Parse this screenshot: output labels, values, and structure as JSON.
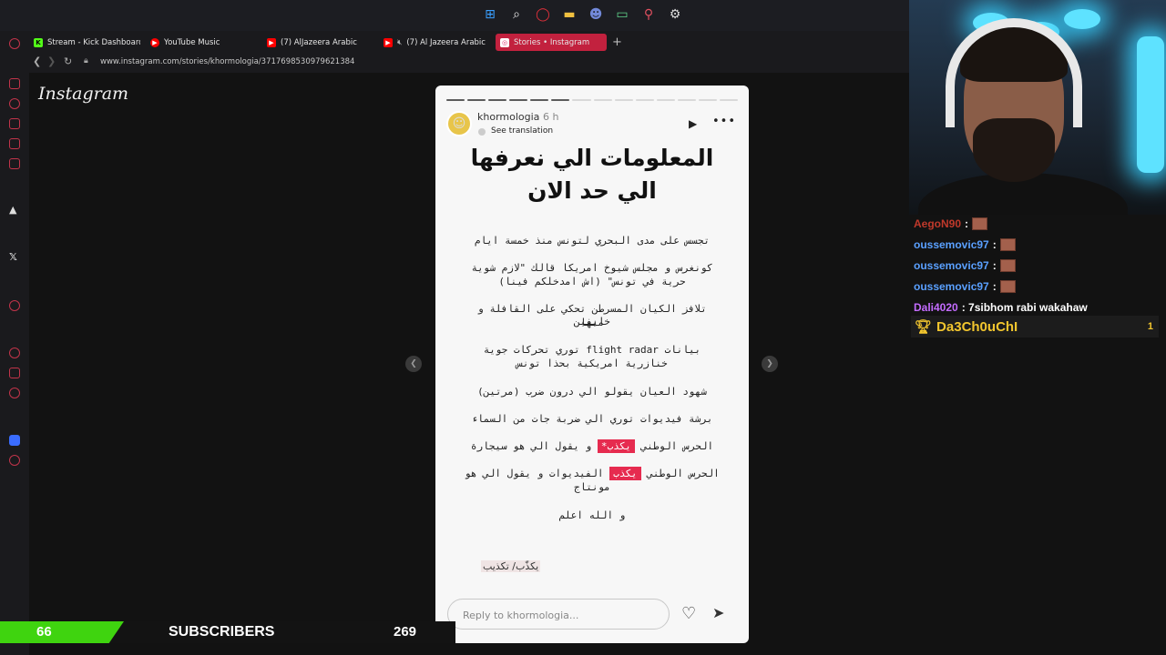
{
  "tabs": [
    {
      "label": "Stream - Kick Dashboard",
      "favicon": "kick-icon",
      "color": "#53fc18"
    },
    {
      "label": "YouTube Music",
      "favicon": "youtube-music-icon",
      "color": "#ff0000"
    },
    {
      "label": "(7) AlJazeera Arabic",
      "favicon": "youtube-icon",
      "color": "#ff0000"
    },
    {
      "label": "(7) Al Jazeera Arabic",
      "favicon": "youtube-icon",
      "color": "#ff0000"
    },
    {
      "label": "Stories • Instagram",
      "favicon": "instagram-icon",
      "color": "#e1306c",
      "active": true
    }
  ],
  "new_tab": "+",
  "address": {
    "url": "www.instagram.com/stories/khormologia/3717698530979621384"
  },
  "instagram": {
    "logo": "Instagram"
  },
  "story": {
    "progress_total": 14,
    "progress_done": 6,
    "username": "khormologia",
    "time": "6 h",
    "see_translation": "See translation",
    "title_line1": "المعلومات الي نعرفها",
    "title_line2": "الي حد الان",
    "lines": [
      {
        "text": "تجسس على مدى البحري لتونس منذ خمسة ايام"
      },
      {
        "text": "كونغرس و مجلس شيوخ امريكا قالك \"لازم شوية"
      },
      {
        "text": "حرية في تونس\" (اش امدخلكم فينا)"
      },
      {
        "text": "تلافز الكيان المسرطن تحكي على القافلة و خايفين"
      },
      {
        "text": "منها"
      },
      {
        "text": "بيانات flight radar توري تحركات جوية"
      },
      {
        "text": "خنازرية امريكية بحذا تونس"
      },
      {
        "text": "شهود العيان يقولو الي درون ضرب (مرتين)"
      },
      {
        "text": "برشة فيديوات توري الي ضربة جات من السماء"
      },
      {
        "pre": "الحرس الوطني",
        "highlight": "يكذب*",
        "post": "و يقول الي هو سيجارة"
      },
      {
        "pre": "الحرس الوطني",
        "highlight": "يكذب",
        "post": "الفيديوات و يقول الي هو"
      },
      {
        "text": "مونتاج"
      },
      {
        "text": "و الله اعلم"
      }
    ],
    "footnote": "يكذّب/ تكذيب",
    "reply_placeholder": "Reply to khormologia..."
  },
  "chat": [
    {
      "user": "AegoN90",
      "color": "#c0392b",
      "text": ":",
      "emote": true
    },
    {
      "user": "oussemovic97",
      "color": "#5aa0ff",
      "text": ":",
      "emote": true
    },
    {
      "user": "oussemovic97",
      "color": "#5aa0ff",
      "text": ":",
      "emote": true
    },
    {
      "user": "oussemovic97",
      "color": "#5aa0ff",
      "text": ":",
      "emote": true
    },
    {
      "user": "Dali4020",
      "color": "#c46cff",
      "text": ": 7sibhom rabi wakahaw",
      "emote": false
    }
  ],
  "top_donor": {
    "name": "Da3Ch0uChI",
    "rank": "1"
  },
  "subs": {
    "count": "66",
    "label": "SUBSCRIBERS",
    "goal": "269",
    "progress": 0.245
  },
  "colors": {
    "accent": "#c2213e",
    "highlight": "#e62b4f",
    "subs_bar": "#3fd40f"
  }
}
